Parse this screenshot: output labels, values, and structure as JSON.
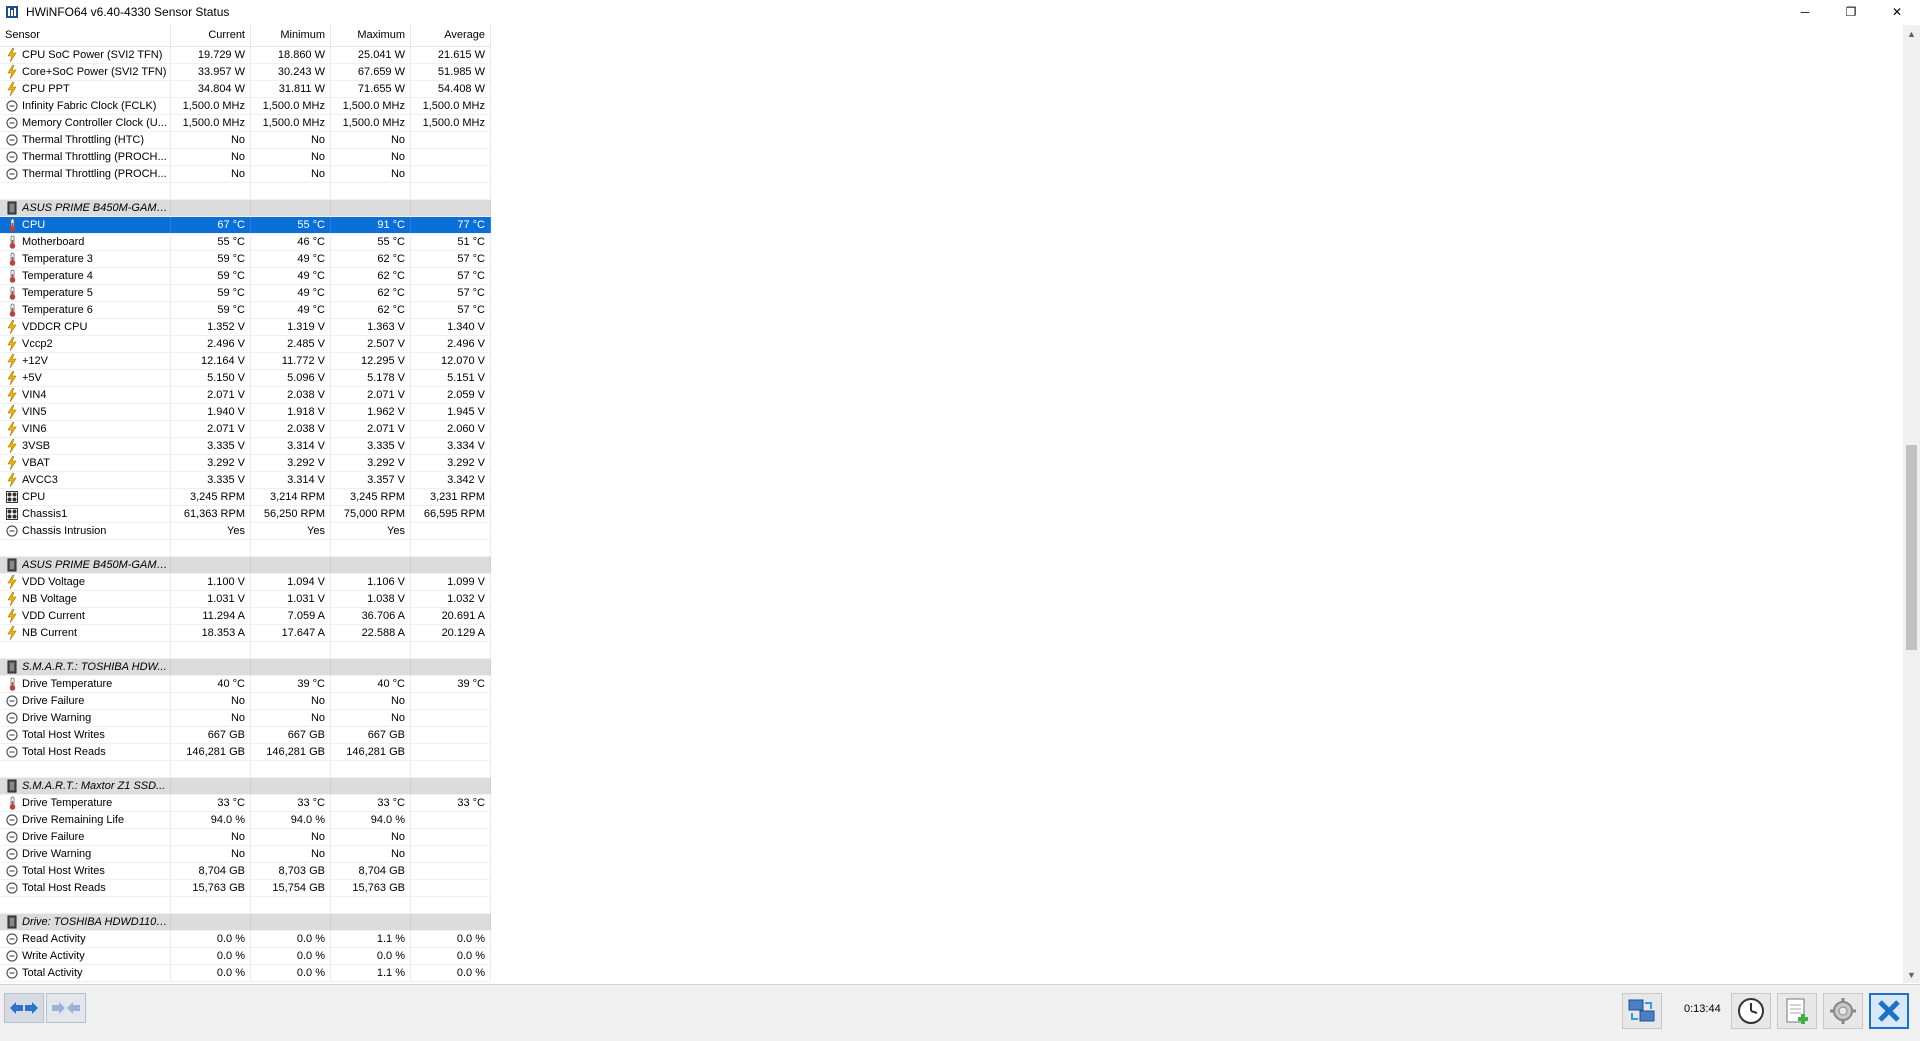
{
  "window": {
    "title": "HWiNFO64 v6.40-4330 Sensor Status",
    "minimize": "─",
    "restore": "❐",
    "close": "✕"
  },
  "columns": [
    "Sensor",
    "Current",
    "Minimum",
    "Maximum",
    "Average"
  ],
  "rows": [
    {
      "type": "item",
      "icon": "lightning-icon",
      "label": "CPU SoC Power (SVI2 TFN)",
      "cur": "19.729 W",
      "min": "18.860 W",
      "max": "25.041 W",
      "avg": "21.615 W"
    },
    {
      "type": "item",
      "icon": "lightning-icon",
      "label": "Core+SoC Power (SVI2 TFN)",
      "cur": "33.957 W",
      "min": "30.243 W",
      "max": "67.659 W",
      "avg": "51.985 W"
    },
    {
      "type": "item",
      "icon": "lightning-icon",
      "label": "CPU PPT",
      "cur": "34.804 W",
      "min": "31.811 W",
      "max": "71.655 W",
      "avg": "54.408 W"
    },
    {
      "type": "item",
      "icon": "circle-icon",
      "label": "Infinity Fabric Clock (FCLK)",
      "cur": "1,500.0 MHz",
      "min": "1,500.0 MHz",
      "max": "1,500.0 MHz",
      "avg": "1,500.0 MHz"
    },
    {
      "type": "item",
      "icon": "circle-icon",
      "label": "Memory Controller Clock (U...",
      "cur": "1,500.0 MHz",
      "min": "1,500.0 MHz",
      "max": "1,500.0 MHz",
      "avg": "1,500.0 MHz"
    },
    {
      "type": "item",
      "icon": "circle-icon",
      "label": "Thermal Throttling (HTC)",
      "cur": "No",
      "min": "No",
      "max": "No",
      "avg": ""
    },
    {
      "type": "item",
      "icon": "circle-icon",
      "label": "Thermal Throttling (PROCH...",
      "cur": "No",
      "min": "No",
      "max": "No",
      "avg": ""
    },
    {
      "type": "item",
      "icon": "circle-icon",
      "label": "Thermal Throttling (PROCH...",
      "cur": "No",
      "min": "No",
      "max": "No",
      "avg": ""
    },
    {
      "type": "blank"
    },
    {
      "type": "group",
      "icon": "chip-icon",
      "label": "ASUS PRIME B450M-GAMIN..."
    },
    {
      "type": "item",
      "icon": "thermometer-icon",
      "label": "CPU",
      "cur": "67 °C",
      "min": "55 °C",
      "max": "91 °C",
      "avg": "77 °C",
      "selected": true
    },
    {
      "type": "item",
      "icon": "thermometer-icon",
      "label": "Motherboard",
      "cur": "55 °C",
      "min": "46 °C",
      "max": "55 °C",
      "avg": "51 °C"
    },
    {
      "type": "item",
      "icon": "thermometer-icon",
      "label": "Temperature 3",
      "cur": "59 °C",
      "min": "49 °C",
      "max": "62 °C",
      "avg": "57 °C"
    },
    {
      "type": "item",
      "icon": "thermometer-icon",
      "label": "Temperature 4",
      "cur": "59 °C",
      "min": "49 °C",
      "max": "62 °C",
      "avg": "57 °C"
    },
    {
      "type": "item",
      "icon": "thermometer-icon",
      "label": "Temperature 5",
      "cur": "59 °C",
      "min": "49 °C",
      "max": "62 °C",
      "avg": "57 °C"
    },
    {
      "type": "item",
      "icon": "thermometer-icon",
      "label": "Temperature 6",
      "cur": "59 °C",
      "min": "49 °C",
      "max": "62 °C",
      "avg": "57 °C"
    },
    {
      "type": "item",
      "icon": "lightning-icon",
      "label": "VDDCR CPU",
      "cur": "1.352 V",
      "min": "1.319 V",
      "max": "1.363 V",
      "avg": "1.340 V"
    },
    {
      "type": "item",
      "icon": "lightning-icon",
      "label": "Vccp2",
      "cur": "2.496 V",
      "min": "2.485 V",
      "max": "2.507 V",
      "avg": "2.496 V"
    },
    {
      "type": "item",
      "icon": "lightning-icon",
      "label": "+12V",
      "cur": "12.164 V",
      "min": "11.772 V",
      "max": "12.295 V",
      "avg": "12.070 V"
    },
    {
      "type": "item",
      "icon": "lightning-icon",
      "label": "+5V",
      "cur": "5.150 V",
      "min": "5.096 V",
      "max": "5.178 V",
      "avg": "5.151 V"
    },
    {
      "type": "item",
      "icon": "lightning-icon",
      "label": "VIN4",
      "cur": "2.071 V",
      "min": "2.038 V",
      "max": "2.071 V",
      "avg": "2.059 V"
    },
    {
      "type": "item",
      "icon": "lightning-icon",
      "label": "VIN5",
      "cur": "1.940 V",
      "min": "1.918 V",
      "max": "1.962 V",
      "avg": "1.945 V"
    },
    {
      "type": "item",
      "icon": "lightning-icon",
      "label": "VIN6",
      "cur": "2.071 V",
      "min": "2.038 V",
      "max": "2.071 V",
      "avg": "2.060 V"
    },
    {
      "type": "item",
      "icon": "lightning-icon",
      "label": "3VSB",
      "cur": "3.335 V",
      "min": "3.314 V",
      "max": "3.335 V",
      "avg": "3.334 V"
    },
    {
      "type": "item",
      "icon": "lightning-icon",
      "label": "VBAT",
      "cur": "3.292 V",
      "min": "3.292 V",
      "max": "3.292 V",
      "avg": "3.292 V"
    },
    {
      "type": "item",
      "icon": "lightning-icon",
      "label": "AVCC3",
      "cur": "3.335 V",
      "min": "3.314 V",
      "max": "3.357 V",
      "avg": "3.342 V"
    },
    {
      "type": "item",
      "icon": "fan-icon",
      "label": "CPU",
      "cur": "3,245 RPM",
      "min": "3,214 RPM",
      "max": "3,245 RPM",
      "avg": "3,231 RPM"
    },
    {
      "type": "item",
      "icon": "fan-icon",
      "label": "Chassis1",
      "cur": "61,363 RPM",
      "min": "56,250 RPM",
      "max": "75,000 RPM",
      "avg": "66,595 RPM"
    },
    {
      "type": "item",
      "icon": "circle-icon",
      "label": "Chassis Intrusion",
      "cur": "Yes",
      "min": "Yes",
      "max": "Yes",
      "avg": ""
    },
    {
      "type": "blank"
    },
    {
      "type": "group",
      "icon": "chip-icon",
      "label": "ASUS PRIME B450M-GAMIN..."
    },
    {
      "type": "item",
      "icon": "lightning-icon",
      "label": "VDD Voltage",
      "cur": "1.100 V",
      "min": "1.094 V",
      "max": "1.106 V",
      "avg": "1.099 V"
    },
    {
      "type": "item",
      "icon": "lightning-icon",
      "label": "NB Voltage",
      "cur": "1.031 V",
      "min": "1.031 V",
      "max": "1.038 V",
      "avg": "1.032 V"
    },
    {
      "type": "item",
      "icon": "lightning-icon",
      "label": "VDD Current",
      "cur": "11.294 A",
      "min": "7.059 A",
      "max": "36.706 A",
      "avg": "20.691 A"
    },
    {
      "type": "item",
      "icon": "lightning-icon",
      "label": "NB Current",
      "cur": "18.353 A",
      "min": "17.647 A",
      "max": "22.588 A",
      "avg": "20.129 A"
    },
    {
      "type": "blank"
    },
    {
      "type": "group",
      "icon": "chip-icon",
      "label": "S.M.A.R.T.: TOSHIBA HDW..."
    },
    {
      "type": "item",
      "icon": "thermometer-icon",
      "label": "Drive Temperature",
      "cur": "40 °C",
      "min": "39 °C",
      "max": "40 °C",
      "avg": "39 °C"
    },
    {
      "type": "item",
      "icon": "circle-icon",
      "label": "Drive Failure",
      "cur": "No",
      "min": "No",
      "max": "No",
      "avg": ""
    },
    {
      "type": "item",
      "icon": "circle-icon",
      "label": "Drive Warning",
      "cur": "No",
      "min": "No",
      "max": "No",
      "avg": ""
    },
    {
      "type": "item",
      "icon": "circle-icon",
      "label": "Total Host Writes",
      "cur": "667 GB",
      "min": "667 GB",
      "max": "667 GB",
      "avg": ""
    },
    {
      "type": "item",
      "icon": "circle-icon",
      "label": "Total Host Reads",
      "cur": "146,281 GB",
      "min": "146,281 GB",
      "max": "146,281 GB",
      "avg": ""
    },
    {
      "type": "blank"
    },
    {
      "type": "group",
      "icon": "chip-icon",
      "label": "S.M.A.R.T.: Maxtor Z1 SSD..."
    },
    {
      "type": "item",
      "icon": "thermometer-icon",
      "label": "Drive Temperature",
      "cur": "33 °C",
      "min": "33 °C",
      "max": "33 °C",
      "avg": "33 °C"
    },
    {
      "type": "item",
      "icon": "circle-icon",
      "label": "Drive Remaining Life",
      "cur": "94.0 %",
      "min": "94.0 %",
      "max": "94.0 %",
      "avg": ""
    },
    {
      "type": "item",
      "icon": "circle-icon",
      "label": "Drive Failure",
      "cur": "No",
      "min": "No",
      "max": "No",
      "avg": ""
    },
    {
      "type": "item",
      "icon": "circle-icon",
      "label": "Drive Warning",
      "cur": "No",
      "min": "No",
      "max": "No",
      "avg": ""
    },
    {
      "type": "item",
      "icon": "circle-icon",
      "label": "Total Host Writes",
      "cur": "8,704 GB",
      "min": "8,703 GB",
      "max": "8,704 GB",
      "avg": ""
    },
    {
      "type": "item",
      "icon": "circle-icon",
      "label": "Total Host Reads",
      "cur": "15,763 GB",
      "min": "15,754 GB",
      "max": "15,763 GB",
      "avg": ""
    },
    {
      "type": "blank"
    },
    {
      "type": "group",
      "icon": "chip-icon",
      "label": "Drive: TOSHIBA HDWD110 ..."
    },
    {
      "type": "item",
      "icon": "circle-icon",
      "label": "Read Activity",
      "cur": "0.0 %",
      "min": "0.0 %",
      "max": "1.1 %",
      "avg": "0.0 %"
    },
    {
      "type": "item",
      "icon": "circle-icon",
      "label": "Write Activity",
      "cur": "0.0 %",
      "min": "0.0 %",
      "max": "0.0 %",
      "avg": "0.0 %"
    },
    {
      "type": "item",
      "icon": "circle-icon",
      "label": "Total Activity",
      "cur": "0.0 %",
      "min": "0.0 %",
      "max": "1.1 %",
      "avg": "0.0 %"
    }
  ],
  "footer": {
    "timer": "0:13:44",
    "buttons": [
      "nav-back-forward-icon",
      "nav-disabled-icon",
      "network-icon",
      "clock-icon",
      "add-report-icon",
      "settings-icon",
      "close-x-icon"
    ]
  },
  "colors": {
    "selection": "#0a6fd6",
    "group_bg": "#dcdcdc",
    "close_btn": "#1a73c9"
  }
}
